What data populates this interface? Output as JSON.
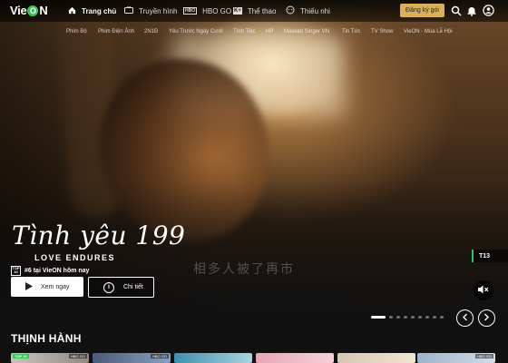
{
  "app": {
    "logo_left": "Vie",
    "logo_circle": "O",
    "logo_right": "N"
  },
  "nav": {
    "items": [
      {
        "label": "Trang chủ",
        "icon": "home-icon"
      },
      {
        "label": "Truyền hình",
        "icon": "tv-icon"
      },
      {
        "label": "HBO GO",
        "icon": "hbo-icon"
      },
      {
        "label": "Thể thao",
        "icon": "sport-icon"
      },
      {
        "label": "Thiếu nhi",
        "icon": "kids-icon"
      }
    ],
    "signup_label": "Đăng ký gói"
  },
  "subnav": {
    "items": [
      "Phim Bộ",
      "Phim Điện Ảnh",
      "2N1Đ",
      "Yêu Trước Ngày Cưới",
      "Tình Tiệc",
      "HP",
      "Masked Singer VN",
      "Tin Tức",
      "TV Show",
      "VieON - Mùa Lễ Hội"
    ]
  },
  "hero": {
    "title": "Tình yêu 199",
    "subtitle": "LOVE ENDURES",
    "rank_icon_text": "TOP 10",
    "rank_text": "#6 tại VieON hôm nay",
    "play_label": "Xem ngay",
    "detail_label": "Chi tiết",
    "age_rating": "T13",
    "overlay_caption": "相多人被了再市",
    "slides_total": 9,
    "slide_active": 1,
    "accent_color": "#3ac25d"
  },
  "trending": {
    "title": "THỊNH HÀNH",
    "items": [
      {
        "tag": "TOP 10",
        "badge": "HBO GO"
      },
      {
        "tag": "",
        "badge": "HBO GO"
      },
      {
        "tag": "",
        "badge": ""
      },
      {
        "tag": "",
        "badge": ""
      },
      {
        "tag": "",
        "badge": ""
      },
      {
        "tag": "",
        "badge": "HBO GO"
      }
    ]
  }
}
